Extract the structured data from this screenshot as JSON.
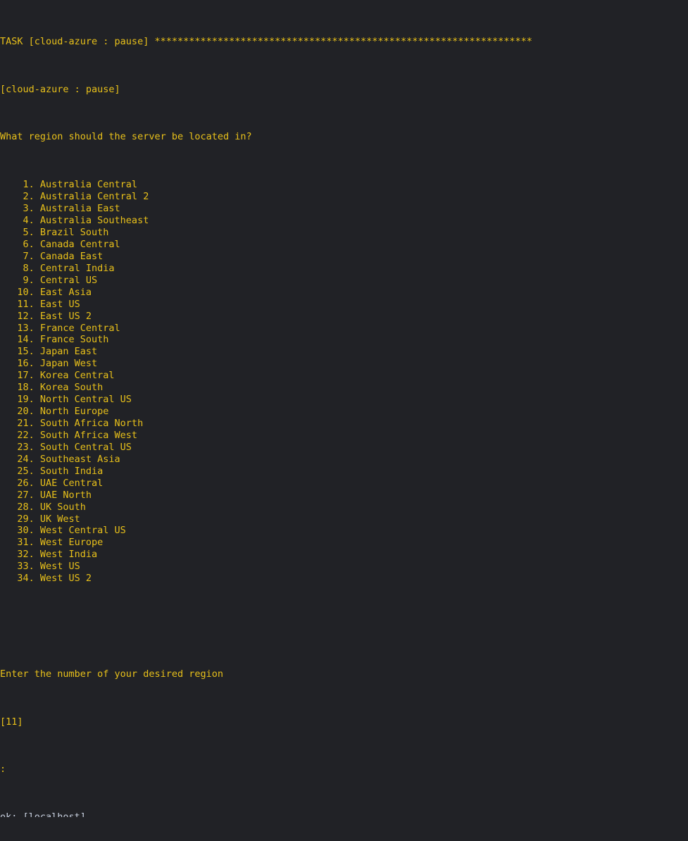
{
  "terminal": {
    "colors": {
      "background": "#212226",
      "foreground": "#e8c01a",
      "secondary_text": "#c9d1e0"
    },
    "task_header": "TASK [cloud-azure : pause] ******************************************************************",
    "module_line": "[cloud-azure : pause]",
    "question": "What region should the server be located in?",
    "regions": [
      {
        "number": "1",
        "name": "Australia Central",
        "text": "    1. Australia Central"
      },
      {
        "number": "2",
        "name": "Australia Central 2",
        "text": "    2. Australia Central 2"
      },
      {
        "number": "3",
        "name": "Australia East",
        "text": "    3. Australia East"
      },
      {
        "number": "4",
        "name": "Australia Southeast",
        "text": "    4. Australia Southeast"
      },
      {
        "number": "5",
        "name": "Brazil South",
        "text": "    5. Brazil South"
      },
      {
        "number": "6",
        "name": "Canada Central",
        "text": "    6. Canada Central"
      },
      {
        "number": "7",
        "name": "Canada East",
        "text": "    7. Canada East"
      },
      {
        "number": "8",
        "name": "Central India",
        "text": "    8. Central India"
      },
      {
        "number": "9",
        "name": "Central US",
        "text": "    9. Central US"
      },
      {
        "number": "10",
        "name": "East Asia",
        "text": "   10. East Asia"
      },
      {
        "number": "11",
        "name": "East US",
        "text": "   11. East US"
      },
      {
        "number": "12",
        "name": "East US 2",
        "text": "   12. East US 2"
      },
      {
        "number": "13",
        "name": "France Central",
        "text": "   13. France Central"
      },
      {
        "number": "14",
        "name": "France South",
        "text": "   14. France South"
      },
      {
        "number": "15",
        "name": "Japan East",
        "text": "   15. Japan East"
      },
      {
        "number": "16",
        "name": "Japan West",
        "text": "   16. Japan West"
      },
      {
        "number": "17",
        "name": "Korea Central",
        "text": "   17. Korea Central"
      },
      {
        "number": "18",
        "name": "Korea South",
        "text": "   18. Korea South"
      },
      {
        "number": "19",
        "name": "North Central US",
        "text": "   19. North Central US"
      },
      {
        "number": "20",
        "name": "North Europe",
        "text": "   20. North Europe"
      },
      {
        "number": "21",
        "name": "South Africa North",
        "text": "   21. South Africa North"
      },
      {
        "number": "22",
        "name": "South Africa West",
        "text": "   22. South Africa West"
      },
      {
        "number": "23",
        "name": "South Central US",
        "text": "   23. South Central US"
      },
      {
        "number": "24",
        "name": "Southeast Asia",
        "text": "   24. Southeast Asia"
      },
      {
        "number": "25",
        "name": "South India",
        "text": "   25. South India"
      },
      {
        "number": "26",
        "name": "UAE Central",
        "text": "   26. UAE Central"
      },
      {
        "number": "27",
        "name": "UAE North",
        "text": "   27. UAE North"
      },
      {
        "number": "28",
        "name": "UK South",
        "text": "   28. UK South"
      },
      {
        "number": "29",
        "name": "UK West",
        "text": "   29. UK West"
      },
      {
        "number": "30",
        "name": "West Central US",
        "text": "   30. West Central US"
      },
      {
        "number": "31",
        "name": "West Europe",
        "text": "   31. West Europe"
      },
      {
        "number": "32",
        "name": "West India",
        "text": "   32. West India"
      },
      {
        "number": "33",
        "name": "West US",
        "text": "   33. West US"
      },
      {
        "number": "34",
        "name": "West US 2",
        "text": "   34. West US 2"
      }
    ],
    "prompt_instruction": "Enter the number of your desired region",
    "default_value": "[11]",
    "prompt_symbol": ":",
    "cut_off_line": "ok: [localhost]"
  }
}
